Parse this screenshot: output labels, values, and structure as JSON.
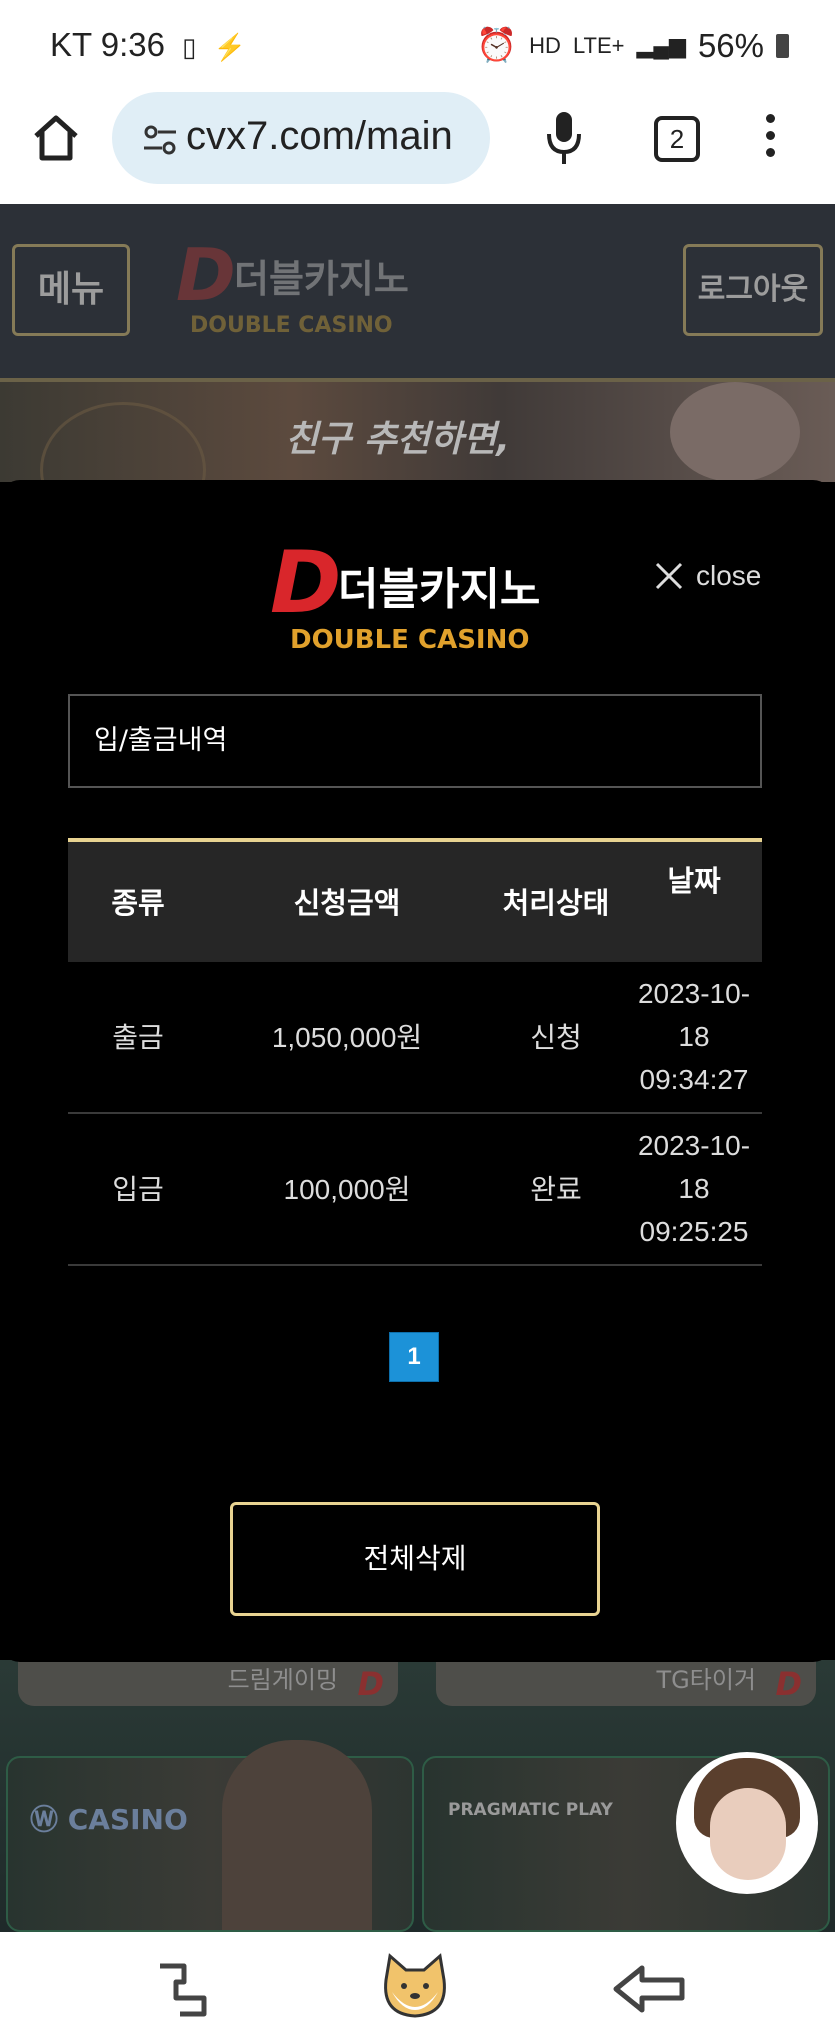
{
  "status_bar": {
    "carrier_time": "KT 9:36",
    "network": "LTE+",
    "battery": "56%"
  },
  "browser": {
    "url": "cvx7.com/main",
    "tab_count": "2"
  },
  "site": {
    "menu_label": "메뉴",
    "logout_label": "로그아웃",
    "logo_korean": "더블카지노",
    "logo_english": "DOUBLE CASINO",
    "banner_text": "친구 추천하면,",
    "provider_left": "드림게이밍",
    "provider_right": "TG타이거",
    "card_left_label": "CASINO",
    "card_right_label": "PRAGMATIC PLAY"
  },
  "modal": {
    "logo_korean": "더블카지노",
    "logo_english": "DOUBLE CASINO",
    "close_label": "close",
    "section_title": "입/출금내역",
    "columns": [
      "종류",
      "신청금액",
      "처리상태",
      "날짜"
    ],
    "rows": [
      {
        "type": "출금",
        "amount": "1,050,000원",
        "status": "신청",
        "date_line1": "2023-10-",
        "date_line2": "18",
        "date_line3": "09:34:27"
      },
      {
        "type": "입금",
        "amount": "100,000원",
        "status": "완료",
        "date_line1": "2023-10-",
        "date_line2": "18",
        "date_line3": "09:25:25"
      }
    ],
    "page": "1",
    "delete_all_label": "전체삭제"
  },
  "colors": {
    "accent_gold": "#e8d391",
    "pager_blue": "#1c92d8",
    "logo_red": "#d9262b"
  }
}
